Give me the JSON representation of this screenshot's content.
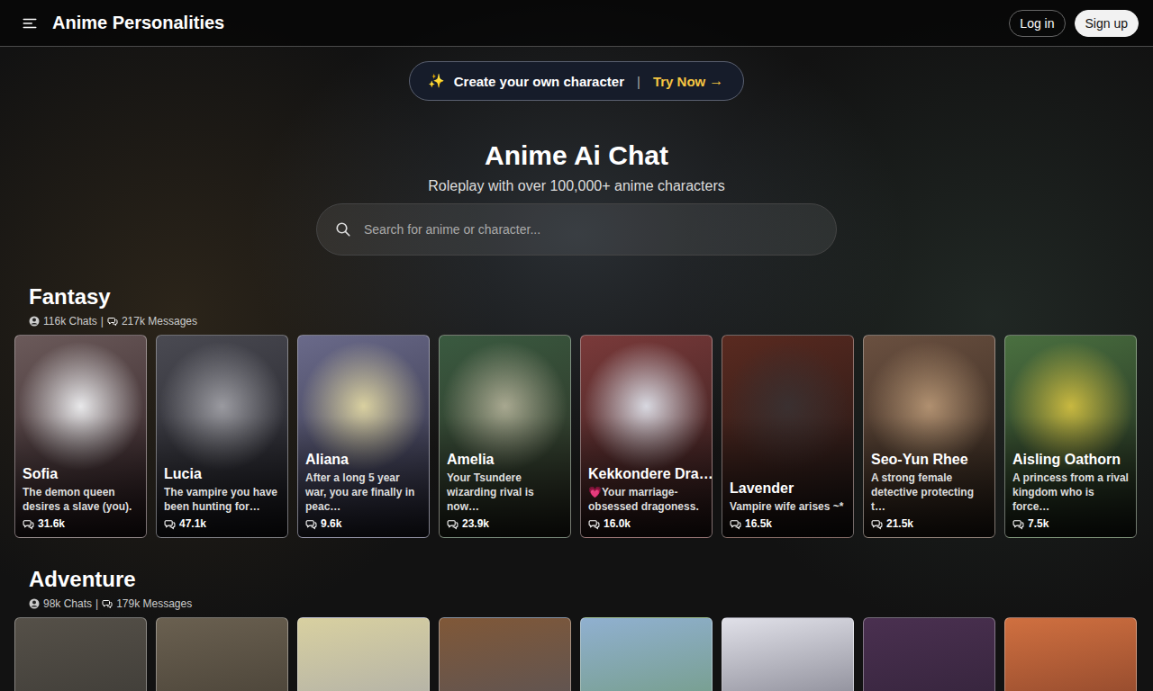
{
  "header": {
    "title": "Anime Personalities",
    "buttons": [
      "Log in",
      "Sign up"
    ]
  },
  "banner": {
    "sparkle": "✨",
    "text": "Create your own character",
    "separator": "|",
    "cta": "Try Now",
    "arrow": "→"
  },
  "hero": {
    "title": "Anime Ai Chat",
    "subtitle": "Roleplay with over 100,000+ anime characters"
  },
  "search": {
    "placeholder": "Search for anime or character..."
  },
  "sections": [
    {
      "title": "Fantasy",
      "chats": "116k Chats",
      "separator": "|",
      "messages": "217k Messages",
      "cards": [
        {
          "name": "Sofia",
          "description": "The demon queen desires a slave (you).",
          "count": "31.6k"
        },
        {
          "name": "Lucia",
          "description": "The vampire you have been hunting for…",
          "count": "47.1k"
        },
        {
          "name": "Aliana",
          "description": "After a long 5 year war, you are finally in peac…",
          "count": "9.6k"
        },
        {
          "name": "Amelia",
          "description": "Your Tsundere wizarding rival is now…",
          "count": "23.9k"
        },
        {
          "name": "Kekkondere Dra…",
          "description": "💗Your marriage-obsessed dragoness.",
          "count": "16.0k"
        },
        {
          "name": "Lavender",
          "description": "Vampire wife arises ~*",
          "count": "16.5k"
        },
        {
          "name": "Seo-Yun Rhee",
          "description": "A strong female detective protecting t…",
          "count": "21.5k"
        },
        {
          "name": "Aisling Oathorn",
          "description": "A princess from a rival kingdom who is force…",
          "count": "7.5k"
        }
      ]
    },
    {
      "title": "Adventure",
      "chats": "98k Chats",
      "separator": "|",
      "messages": "179k Messages",
      "cards": [
        {},
        {},
        {},
        {},
        {},
        {},
        {},
        {}
      ]
    }
  ]
}
